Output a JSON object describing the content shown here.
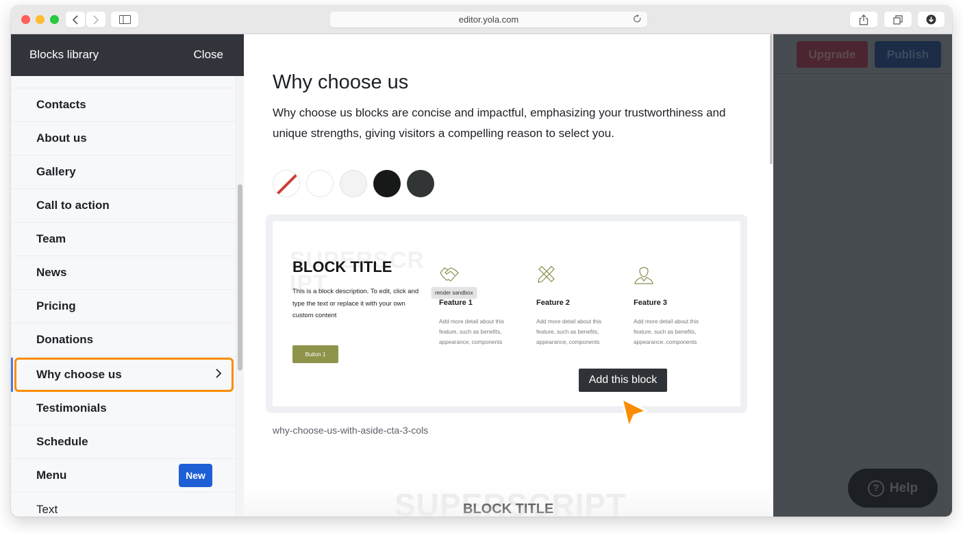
{
  "browser": {
    "url": "editor.yola.com",
    "icons": {
      "back": "chevron-left-icon",
      "forward": "chevron-right-icon",
      "sidebar": "sidebar-icon",
      "reload": "reload-icon",
      "share": "share-icon",
      "tabs": "tabs-icon",
      "download": "download-icon"
    }
  },
  "editor": {
    "upgrade_label": "Upgrade",
    "publish_label": "Publish",
    "help_label": "Help",
    "colors": {
      "upgrade": "#4b2530",
      "publish": "#1c2c47"
    }
  },
  "library": {
    "title": "Blocks library",
    "close_label": "Close",
    "items": [
      {
        "label": "Contacts"
      },
      {
        "label": "About us"
      },
      {
        "label": "Gallery"
      },
      {
        "label": "Call to action"
      },
      {
        "label": "Team"
      },
      {
        "label": "News"
      },
      {
        "label": "Pricing"
      },
      {
        "label": "Donations"
      },
      {
        "label": "Why choose us",
        "selected": true
      },
      {
        "label": "Testimonials"
      },
      {
        "label": "Schedule"
      },
      {
        "label": "Menu",
        "badge": "New"
      },
      {
        "label": "Text"
      }
    ],
    "selected_color": "#fb8c00",
    "badge_color": "#1f5fd5"
  },
  "preview": {
    "title": "Why choose us",
    "description": "Why choose us blocks are concise and impactful, emphasizing your trustworthiness and unique strengths, giving visitors a compelling reason to select you.",
    "swatches": [
      {
        "name": "none",
        "color": "none"
      },
      {
        "name": "white",
        "color": "#ffffff"
      },
      {
        "name": "light-gray",
        "color": "#f3f3f3"
      },
      {
        "name": "black",
        "color": "#171918"
      },
      {
        "name": "dark-gray",
        "color": "#313536"
      }
    ],
    "block": {
      "superscript": "SUPERSCRIPT",
      "title": "BLOCK TITLE",
      "description": "This is a block description. To edit, click and type the text or replace it with your own custom content",
      "button_label": "Button 1",
      "button_color": "#8e944a",
      "sandbox_tooltip": "render sandbox",
      "features": [
        {
          "icon": "handshake-icon",
          "name": "Feature 1",
          "description": "Add more detail about this feature, such as benefits, appearance, components"
        },
        {
          "icon": "pencil-ruler-icon",
          "name": "Feature 2",
          "description": "Add more detail about this feature, such as benefits, appearance, components"
        },
        {
          "icon": "person-icon",
          "name": "Feature 3",
          "description": "Add more detail about this feature, such as benefits, appearance, components"
        }
      ],
      "add_label": "Add this block",
      "slug": "why-choose-us-with-aside-cta-3-cols"
    },
    "next_block": {
      "superscript": "SUPERSCRIPT",
      "title": "BLOCK TITLE"
    }
  }
}
